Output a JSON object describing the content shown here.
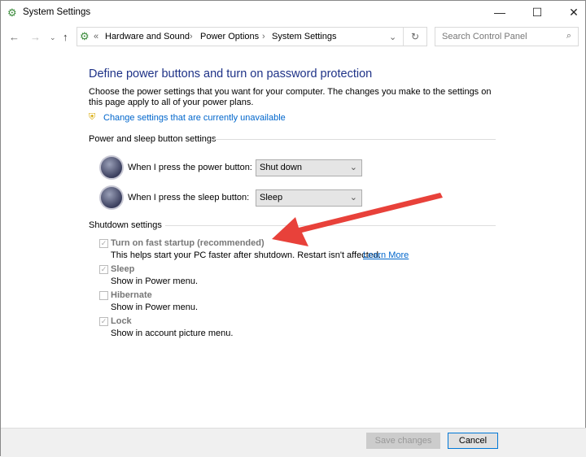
{
  "window": {
    "title": "System Settings"
  },
  "address": {
    "breadcrumb": [
      "Hardware and Sound",
      "Power Options",
      "System Settings"
    ],
    "prefix": "«"
  },
  "search": {
    "placeholder": "Search Control Panel"
  },
  "main": {
    "heading": "Define power buttons and turn on password protection",
    "description": "Choose the power settings that you want for your computer. The changes you make to the settings on this page apply to all of your power plans.",
    "change_link": "Change settings that are currently unavailable",
    "power_section": "Power and sleep button settings",
    "power_label": "When I press the power button:",
    "power_value": "Shut down",
    "sleep_label": "When I press the sleep button:",
    "sleep_value": "Sleep",
    "shutdown_section": "Shutdown settings",
    "options": [
      {
        "label": "Turn on fast startup (recommended)",
        "desc": "This helps start your PC faster after shutdown. Restart isn't affected.",
        "checked": true
      },
      {
        "label": "Sleep",
        "desc": "Show in Power menu.",
        "checked": true
      },
      {
        "label": "Hibernate",
        "desc": "Show in Power menu.",
        "checked": false
      },
      {
        "label": "Lock",
        "desc": "Show in account picture menu.",
        "checked": true
      }
    ],
    "learn_more": "Learn More"
  },
  "footer": {
    "save": "Save changes",
    "cancel": "Cancel"
  },
  "colors": {
    "annotation_arrow": "#e8413a",
    "heading": "#1e3287"
  }
}
